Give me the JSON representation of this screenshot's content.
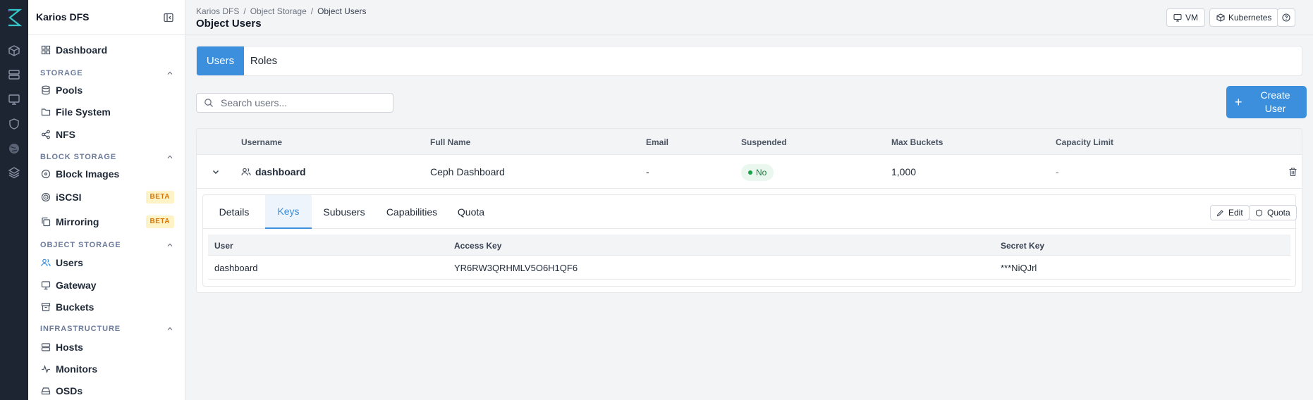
{
  "app": {
    "title": "Karios DFS"
  },
  "rail": {
    "icons": [
      "logo-icon",
      "cube-icon",
      "server-icon",
      "monitor-icon",
      "shield-icon",
      "globe-icon",
      "layers-icon"
    ]
  },
  "sidebar": {
    "dashboard": "Dashboard",
    "sections": {
      "storage": "STORAGE",
      "block_storage": "BLOCK STORAGE",
      "object_storage": "OBJECT STORAGE",
      "infrastructure": "INFRASTRUCTURE"
    },
    "items": {
      "pools": "Pools",
      "file_system": "File System",
      "nfs": "NFS",
      "block_images": "Block Images",
      "iscsi": "iSCSI",
      "mirroring": "Mirroring",
      "users": "Users",
      "gateway": "Gateway",
      "buckets": "Buckets",
      "hosts": "Hosts",
      "monitors": "Monitors",
      "osds": "OSDs"
    },
    "beta_label": "BETA"
  },
  "header": {
    "breadcrumb": [
      "Karios DFS",
      "/",
      "Object Storage",
      "/",
      "Object Users"
    ],
    "title": "Object Users",
    "vm_label": "VM",
    "kubernetes_label": "Kubernetes"
  },
  "tabs": {
    "users": "Users",
    "roles": "Roles"
  },
  "search": {
    "placeholder": "Search users..."
  },
  "create_button": {
    "label": "Create User"
  },
  "table": {
    "columns": [
      "Username",
      "Full Name",
      "Email",
      "Suspended",
      "Max Buckets",
      "Capacity Limit"
    ],
    "rows": [
      {
        "username": "dashboard",
        "full_name": "Ceph Dashboard",
        "email": "-",
        "suspended": "No",
        "max_buckets": "1,000",
        "capacity_limit": "-"
      }
    ]
  },
  "detail": {
    "tabs": [
      "Details",
      "Keys",
      "Subusers",
      "Capabilities",
      "Quota"
    ],
    "active_tab": "Keys",
    "edit_label": "Edit",
    "quota_label": "Quota",
    "keys": {
      "columns": [
        "User",
        "Access Key",
        "Secret Key"
      ],
      "rows": [
        {
          "user": "dashboard",
          "access_key": "YR6RW3QRHMLV5O6H1QF6",
          "secret_key": "***NiQJrl"
        }
      ]
    }
  },
  "colors": {
    "accent": "#3b8fdd",
    "rail_bg": "#1e2532",
    "beta_text": "#d97706",
    "beta_bg": "#fef3c7",
    "status_green": "#16a34a"
  }
}
